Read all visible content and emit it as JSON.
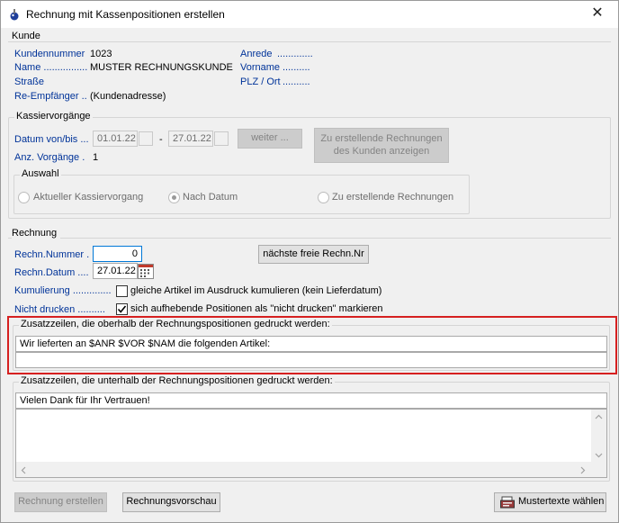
{
  "window": {
    "title": "Rechnung mit Kassenpositionen erstellen",
    "close_glyph": "✕"
  },
  "kunde": {
    "title": "Kunde",
    "kundennummer_label": "Kundennummer",
    "kundennummer_value": "1023",
    "name_label": "Name ................",
    "name_value": "MUSTER RECHNUNGSKUNDE",
    "strasse_label": "Straße",
    "reempf_label": "Re-Empfänger ..",
    "reempf_value": "(Kundenadresse)",
    "anrede_label": "Anrede",
    "anrede_dots": ".............",
    "vorname_label": "Vorname",
    "vorname_dots": "..........",
    "plz_label": "PLZ / Ort",
    "plz_dots": ".........."
  },
  "kassier": {
    "title": "Kassiervorgänge",
    "datum_label": "Datum von/bis ...",
    "date_from": "01.01.22",
    "date_to": "27.01.22",
    "dash": "-",
    "weiter_label": "weiter ...",
    "zu_button_line1": "Zu erstellende Rechnungen",
    "zu_button_line2": "des Kunden anzeigen",
    "anz_label": "Anz. Vorgänge .",
    "anz_value": "1"
  },
  "auswahl": {
    "title": "Auswahl",
    "opt1": "Aktueller Kassiervorgang",
    "opt2": "Nach Datum",
    "opt3": "Zu erstellende Rechnungen"
  },
  "rechnung": {
    "title": "Rechnung",
    "nummer_label": "Rechn.Nummer .",
    "nummer_value": "0",
    "naechste_label": "nächste freie Rechn.Nr",
    "datum_label": "Rechn.Datum ....",
    "datum_value": "27.01.22",
    "kumulierung_label": "Kumulierung ..............",
    "kumulierung_text": "gleiche Artikel im Ausdruck kumulieren (kein Lieferdatum)",
    "nicht_label": "Nicht drucken ..........",
    "nicht_text": "sich aufhebende Positionen als \"nicht drucken\" markieren"
  },
  "oberhalb": {
    "title": "Zusatzzeilen, die oberhalb der Rechnungspositionen gedruckt werden:",
    "line1": "Wir lieferten an $ANR $VOR $NAM die folgenden Artikel:",
    "line2": ""
  },
  "unterhalb": {
    "title": "Zusatzzeilen, die unterhalb der Rechnungspositionen gedruckt werden:",
    "line1": "Vielen Dank für Ihr Vertrauen!"
  },
  "footer": {
    "erstellen_label": "Rechnung erstellen",
    "vorschau_label": "Rechnungsvorschau",
    "muster_label": "Mustertexte wählen"
  }
}
